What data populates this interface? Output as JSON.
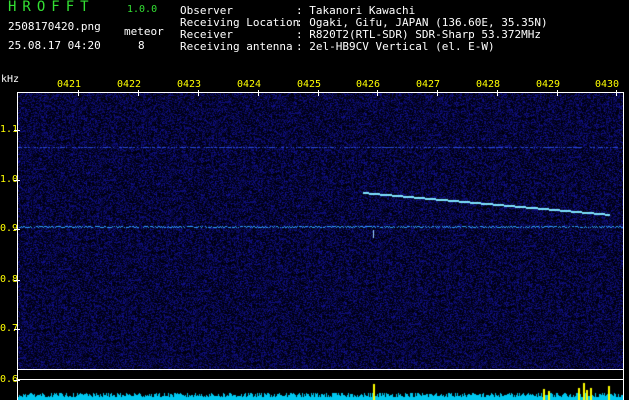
{
  "header": {
    "app_title": "HROFFT",
    "app_version": "1.0.0",
    "file_name": "2508170420.png",
    "timestamp": "25.08.17 04:20",
    "meteor_label": "meteor",
    "meteor_count": "8"
  },
  "info": [
    {
      "label": "Observer",
      "value": ": Takanori Kawachi"
    },
    {
      "label": "Receiving Location",
      "value": ": Ogaki, Gifu, JAPAN (136.60E, 35.35N)"
    },
    {
      "label": "Receiver",
      "value": ": R820T2(RTL-SDR) SDR-Sharp 53.372MHz"
    },
    {
      "label": "Receiving antenna",
      "value": ": 2el-HB9CV Vertical (el. E-W)"
    }
  ],
  "axes": {
    "y_unit": "kHz",
    "x_ticks": [
      "0421",
      "0422",
      "0423",
      "0424",
      "0425",
      "0426",
      "0427",
      "0428",
      "0429",
      "0430"
    ],
    "y_ticks": [
      "1.1",
      "1.0",
      "0.9",
      "0.8",
      "0.7",
      "0.6"
    ]
  },
  "colors": {
    "background": "#000000",
    "noise": "#14148c",
    "signal": "#2fb4ff",
    "trace": "#7fe6ff",
    "tick_text": "#ffff00",
    "title_text": "#33e033",
    "level_bar": "#00d8ff",
    "level_peak": "#ffff00"
  }
}
